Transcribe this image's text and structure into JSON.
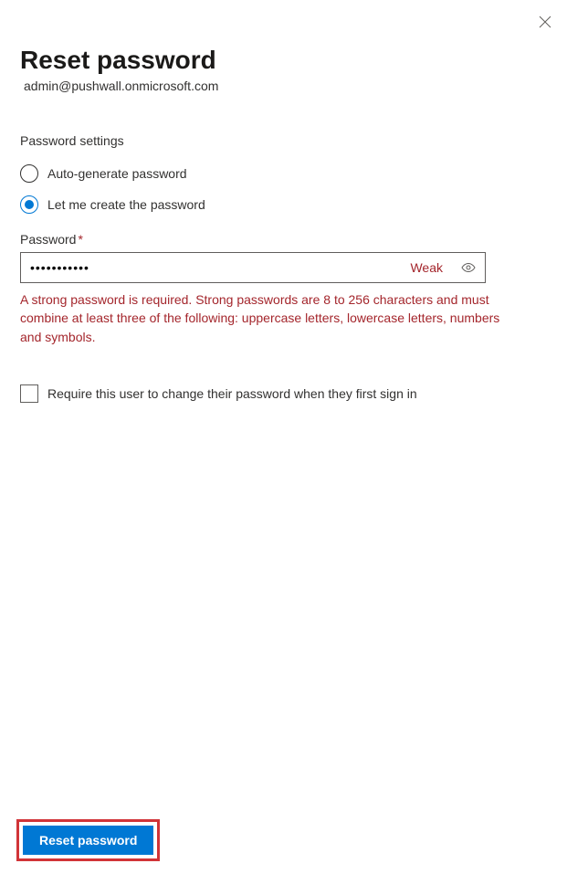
{
  "header": {
    "title": "Reset password",
    "subtitle": "admin@pushwall.onmicrosoft.com"
  },
  "settings": {
    "section_label": "Password settings",
    "options": {
      "auto": "Auto-generate password",
      "manual": "Let me create the password"
    },
    "selected": "manual"
  },
  "password": {
    "label": "Password",
    "required_mark": "*",
    "value": "•••••••••••",
    "strength": "Weak",
    "error": "A strong password is required. Strong passwords are 8 to 256 characters and must combine at least three of the following: uppercase letters, lowercase letters, numbers and symbols."
  },
  "require_change": {
    "label": "Require this user to change their password when they first sign in",
    "checked": false
  },
  "footer": {
    "submit_label": "Reset password"
  }
}
